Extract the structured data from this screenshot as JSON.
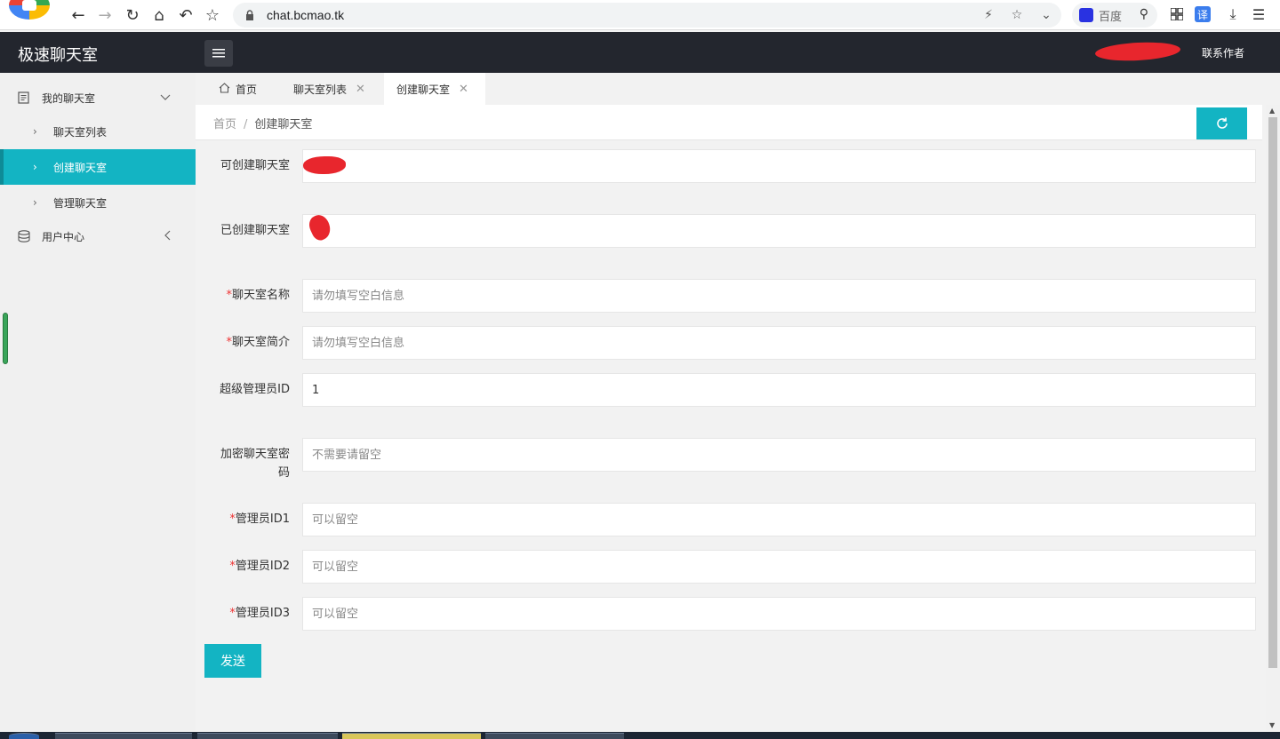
{
  "browser": {
    "url": "chat.bcmao.tk",
    "search_label": "百度",
    "icons": [
      "back-icon",
      "forward-icon",
      "reload-icon",
      "home-icon",
      "undo-icon",
      "star-icon",
      "lock-icon",
      "lightning-icon",
      "bookmark-icon",
      "chevron-down-icon",
      "baidu-icon",
      "search-icon",
      "apps-icon",
      "translate-icon",
      "download-icon",
      "menu-icon"
    ],
    "translate_label": "译"
  },
  "header": {
    "app_title": "极速聊天室",
    "contact": "联系作者"
  },
  "sidebar": {
    "groups": [
      {
        "label": "我的聊天室",
        "icon": "document-icon",
        "arrow": "chevron-down-icon"
      },
      {
        "label": "用户中心",
        "icon": "database-icon",
        "arrow": "chevron-left-icon"
      }
    ],
    "items": [
      {
        "label": "聊天室列表",
        "active": false
      },
      {
        "label": "创建聊天室",
        "active": true
      },
      {
        "label": "管理聊天室",
        "active": false
      }
    ]
  },
  "tabs": [
    {
      "label": "首页",
      "icon": "home-icon",
      "closable": false
    },
    {
      "label": "聊天室列表",
      "closable": true
    },
    {
      "label": "创建聊天室",
      "closable": true,
      "active": true
    }
  ],
  "breadcrumb": {
    "home": "首页",
    "separator": "/",
    "current": "创建聊天室"
  },
  "form": {
    "can_create_label": "可创建聊天室",
    "created_label": "已创建聊天室",
    "name": {
      "label": "聊天室名称",
      "placeholder": "请勿填写空白信息",
      "required": true
    },
    "intro": {
      "label": "聊天室简介",
      "placeholder": "请勿填写空白信息",
      "required": true
    },
    "super_admin": {
      "label": "超级管理员ID",
      "value": "1"
    },
    "password": {
      "label": "加密聊天室密码",
      "placeholder": "不需要请留空"
    },
    "admin1": {
      "label": "管理员ID1",
      "placeholder": "可以留空",
      "required": true
    },
    "admin2": {
      "label": "管理员ID2",
      "placeholder": "可以留空",
      "required": true
    },
    "admin3": {
      "label": "管理员ID3",
      "placeholder": "可以留空",
      "required": true
    },
    "required_mark": "*",
    "submit": "发送"
  },
  "colors": {
    "accent": "#13b4c3",
    "header_bg": "#23262e",
    "redaction": "#e8262d"
  }
}
